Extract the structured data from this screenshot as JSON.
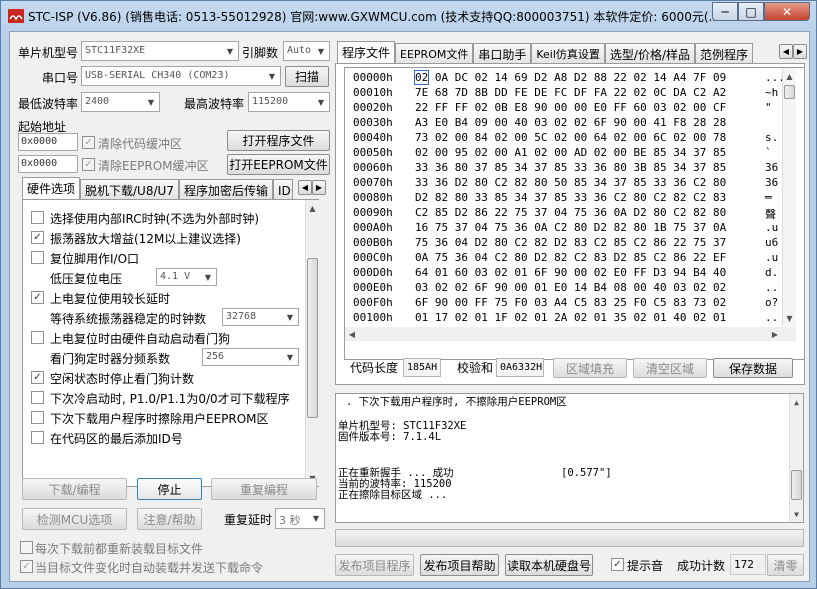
{
  "window": {
    "title": "STC-ISP (V6.86) (销售电话: 0513-55012928) 官网:www.GXWMCU.com (技术支持QQ:800003751) 本软件定价: 6000元(...",
    "min": "─",
    "max": "□",
    "close": "✕"
  },
  "left": {
    "mcu_type_label": "单片机型号",
    "mcu_type": "STC11F32XE",
    "pins_label": "引脚数",
    "pins": "Auto",
    "port_label": "串口号",
    "port": "USB-SERIAL CH340 (COM23)",
    "scan": "扫描",
    "min_baud_label": "最低波特率",
    "min_baud": "2400",
    "max_baud_label": "最高波特率",
    "max_baud": "115200",
    "start_addr_label": "起始地址",
    "code_addr": "0x0000",
    "clear_code_buf": "清除代码缓冲区",
    "open_prog": "打开程序文件",
    "eeprom_addr": "0x0000",
    "clear_eeprom_buf": "清除EEPROM缓冲区",
    "open_eeprom": "打开EEPROM文件",
    "tabs": [
      "硬件选项",
      "脱机下载/U8/U7",
      "程序加密后传输",
      "ID号"
    ],
    "options": [
      {
        "text": "选择使用内部IRC时钟(不选为外部时钟)",
        "checked": false
      },
      {
        "text": "振荡器放大增益(12M以上建议选择)",
        "checked": true
      },
      {
        "text": "复位脚用作I/O口",
        "checked": false
      },
      {
        "text": "低压复位电压",
        "value": "4.1 V"
      },
      {
        "text": "上电复位使用较长延时",
        "checked": true
      },
      {
        "text": "等待系统振荡器稳定的时钟数",
        "value": "32768"
      },
      {
        "text": "上电复位时由硬件自动启动看门狗",
        "checked": false
      },
      {
        "text": "看门狗定时器分频系数",
        "value": "256"
      },
      {
        "text": "空闲状态时停止看门狗计数",
        "checked": true
      },
      {
        "text": "下次冷启动时, P1.0/P1.1为0/0才可下载程序",
        "checked": false
      },
      {
        "text": "下次下载用户程序时擦除用户EEPROM区",
        "checked": false
      },
      {
        "text": "在代码区的最后添加ID号",
        "checked": false
      }
    ],
    "download": "下载/编程",
    "stop": "停止",
    "reprogram": "重复编程",
    "check_mcu": "检测MCU选项",
    "help": "注意/帮助",
    "repeat_delay_label": "重复延时",
    "repeat_delay": "3 秒",
    "reload_each": "每次下载前都重新装载目标文件",
    "auto_load": "当目标文件变化时自动装载并发送下载命令"
  },
  "right": {
    "tabs": [
      "程序文件",
      "EEPROM文件",
      "串口助手",
      "Keil仿真设置",
      "选型/价格/样品",
      "范例程序"
    ],
    "hex_rows": [
      {
        "addr": "00000h",
        "bytes": "02 0A DC 02 14 69 D2 A8 D2 88 22 02 14 A4 7F 09",
        "ascii": "..."
      },
      {
        "addr": "00010h",
        "bytes": "7E 68 7D 8B DD FE DE FC DF FA 22 02 0C DA C2 A2",
        "ascii": "~h"
      },
      {
        "addr": "00020h",
        "bytes": "22 FF FF 02 0B E8 90 00 00 E0 FF 60 03 02 00 CF",
        "ascii": "\""
      },
      {
        "addr": "00030h",
        "bytes": "A3 E0 B4 09 00 40 03 02 02 6F 90 00 41 F8 28 28",
        "ascii": ""
      },
      {
        "addr": "00040h",
        "bytes": "73 02 00 84 02 00 5C 02 00 64 02 00 6C 02 00 78",
        "ascii": "s."
      },
      {
        "addr": "00050h",
        "bytes": "02 00 95 02 00 A1 02 00 AD 02 00 BE 85 34 37 85",
        "ascii": "`"
      },
      {
        "addr": "00060h",
        "bytes": "33 36 80 37 85 34 37 85 33 36 80 3B 85 34 37 85",
        "ascii": "36"
      },
      {
        "addr": "00070h",
        "bytes": "33 36 D2 80 C2 82 80 50 85 34 37 85 33 36 C2 80",
        "ascii": "36"
      },
      {
        "addr": "00080h",
        "bytes": "D2 82 80 33 85 34 37 85 33 36 C2 80 C2 82 C2 83",
        "ascii": "═"
      },
      {
        "addr": "00090h",
        "bytes": "C2 85 D2 86 22 75 37 04 75 36 0A D2 80 C2 82 80",
        "ascii": "聲"
      },
      {
        "addr": "000A0h",
        "bytes": "16 75 37 04 75 36 0A C2 80 D2 82 80 1B 75 37 0A",
        "ascii": ".u"
      },
      {
        "addr": "000B0h",
        "bytes": "75 36 04 D2 80 C2 82 D2 83 C2 85 C2 86 22 75 37",
        "ascii": "u6"
      },
      {
        "addr": "000C0h",
        "bytes": "0A 75 36 04 C2 80 D2 82 C2 83 D2 85 C2 86 22 EF",
        "ascii": ".u"
      },
      {
        "addr": "000D0h",
        "bytes": "64 01 60 03 02 01 6F 90 00 02 E0 FF D3 94 B4 40",
        "ascii": "d."
      },
      {
        "addr": "000E0h",
        "bytes": "03 02 02 6F 90 00 01 E0 14 B4 08 00 40 03 02 02",
        "ascii": ".."
      },
      {
        "addr": "000F0h",
        "bytes": "6F 90 00 FF 75 F0 03 A4 C5 83 25 F0 C5 83 73 02",
        "ascii": "o?"
      },
      {
        "addr": "00100h",
        "bytes": "01 17 02 01 1F 02 01 2A 02 01 35 02 01 40 02 01",
        "ascii": ".."
      }
    ],
    "code_len_label": "代码长度",
    "code_len": "185AH",
    "checksum_label": "校验和",
    "checksum": "0A6332H",
    "fill_area": "区域填充",
    "clear_area": "清空区域",
    "save_data": "保存数据",
    "log_lines": [
      ". 下次下载用户程序时, 不擦除用户EEPROM区",
      "",
      "单片机型号: STC11F32XE",
      "固件版本号: 7.1.4L",
      "",
      "",
      "正在重新握手 ... 成功                 [0.577\"]",
      "当前的波特率: 115200",
      "正在擦除目标区域 ..."
    ],
    "publish_prog": "发布项目程序",
    "publish_help": "发布项目帮助",
    "read_disk": "读取本机硬盘号",
    "beep_label": "提示音",
    "success_label": "成功计数",
    "success_count": "172",
    "clear": "清零"
  }
}
